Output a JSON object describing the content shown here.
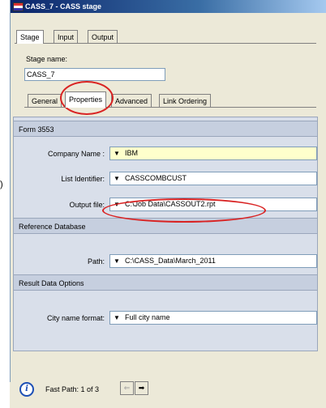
{
  "window": {
    "title": "CASS_7 - CASS stage"
  },
  "top_tabs": [
    "Stage",
    "Input",
    "Output"
  ],
  "stage_name": {
    "label": "Stage name:",
    "value": "CASS_7"
  },
  "sub_tabs": [
    "General",
    "Properties",
    "Advanced",
    "Link Ordering"
  ],
  "properties": {
    "sections": {
      "form": "Form 3553",
      "reference": "Reference Database",
      "result": "Result Data Options"
    },
    "fields": [
      {
        "label": "Company Name :",
        "value": "IBM"
      },
      {
        "label": "List Identifier:",
        "value": "CASSCOMBCUST"
      },
      {
        "label": "Output file:",
        "value": "C:\\Job Data\\CASSOUT2.rpt"
      },
      {
        "label": "Path:",
        "value": "C:\\CASS_Data\\March_2011"
      },
      {
        "label": "City name format:",
        "value": "Full city name"
      }
    ]
  },
  "footer": {
    "fast_path": "Fast Path: 1 of 3"
  },
  "icons": {
    "dropdown_arrow": "▼",
    "back_arrow": "⇐",
    "forward_arrow": "➡",
    "info": "i"
  },
  "colors": {
    "annotation_red": "#d92323",
    "company_field_bg": "#ffffcc"
  }
}
